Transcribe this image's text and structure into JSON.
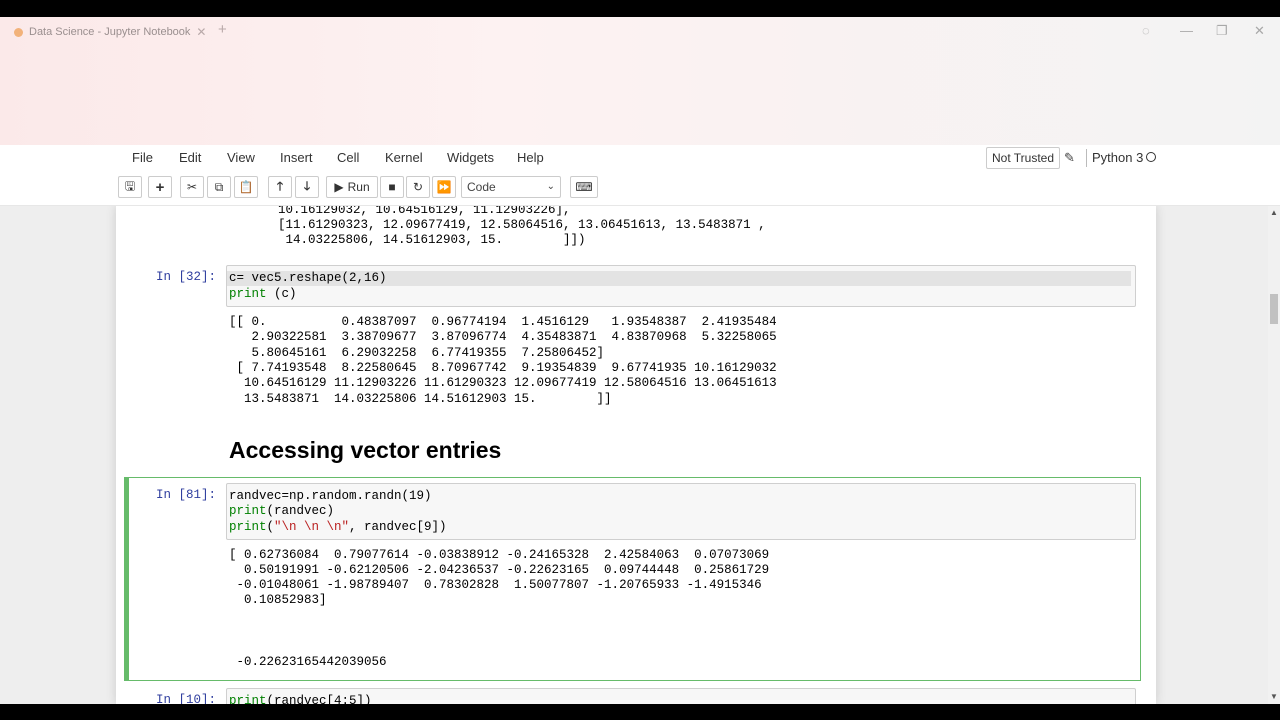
{
  "tab": {
    "title": "Data Science - Jupyter Notebook"
  },
  "menu": [
    "File",
    "Edit",
    "View",
    "Insert",
    "Cell",
    "Kernel",
    "Widgets",
    "Help"
  ],
  "status": {
    "trust": "Not Trusted",
    "kernel": "Python 3"
  },
  "toolbar": {
    "run_label": "Run",
    "cell_type": "Code"
  },
  "cells": {
    "prev_output": [
      "10.16129032, 10.64516129, 11.12903226],",
      "[11.61290323, 12.09677419, 12.58064516, 13.06451613, 13.5483871 ,",
      " 14.03225806, 14.51612903, 15.        ]])"
    ],
    "c32": {
      "prompt": "In [32]:",
      "line1": "c= vec5.reshape(2,16)",
      "line2_fn": "print",
      "line2_rest": " (c)",
      "output": [
        "[[ 0.          0.48387097  0.96774194  1.4516129   1.93548387  2.41935484",
        "   2.90322581  3.38709677  3.87096774  4.35483871  4.83870968  5.32258065",
        "   5.80645161  6.29032258  6.77419355  7.25806452]",
        " [ 7.74193548  8.22580645  8.70967742  9.19354839  9.67741935 10.16129032",
        "  10.64516129 11.12903226 11.61290323 12.09677419 12.58064516 13.06451613",
        "  13.5483871  14.03225806 14.51612903 15.        ]]"
      ]
    },
    "heading": "Accessing vector entries",
    "c81": {
      "prompt": "In [81]:",
      "line1": "randvec=np.random.randn(19)",
      "line2_fn": "print",
      "line2_rest": "(randvec)",
      "line3_fn": "print",
      "line3_str": "\"\\n \\n \\n\"",
      "line3_rest": ", randvec[9])",
      "line3_open": "(",
      "output": [
        "[ 0.62736084  0.79077614 -0.03838912 -0.24165328  2.42584063  0.07073069",
        "  0.50191991 -0.62120506 -2.04236537 -0.22623165  0.09744448  0.25861729",
        " -0.01048061 -1.98789407  0.78302828  1.50077807 -1.20765933 -1.4915346",
        "  0.10852983]"
      ],
      "scalar": " -0.22623165442039056"
    },
    "c10": {
      "prompt": "In [10]:",
      "line1_fn": "print",
      "line1_rest": "(randvec[4:5])"
    }
  }
}
